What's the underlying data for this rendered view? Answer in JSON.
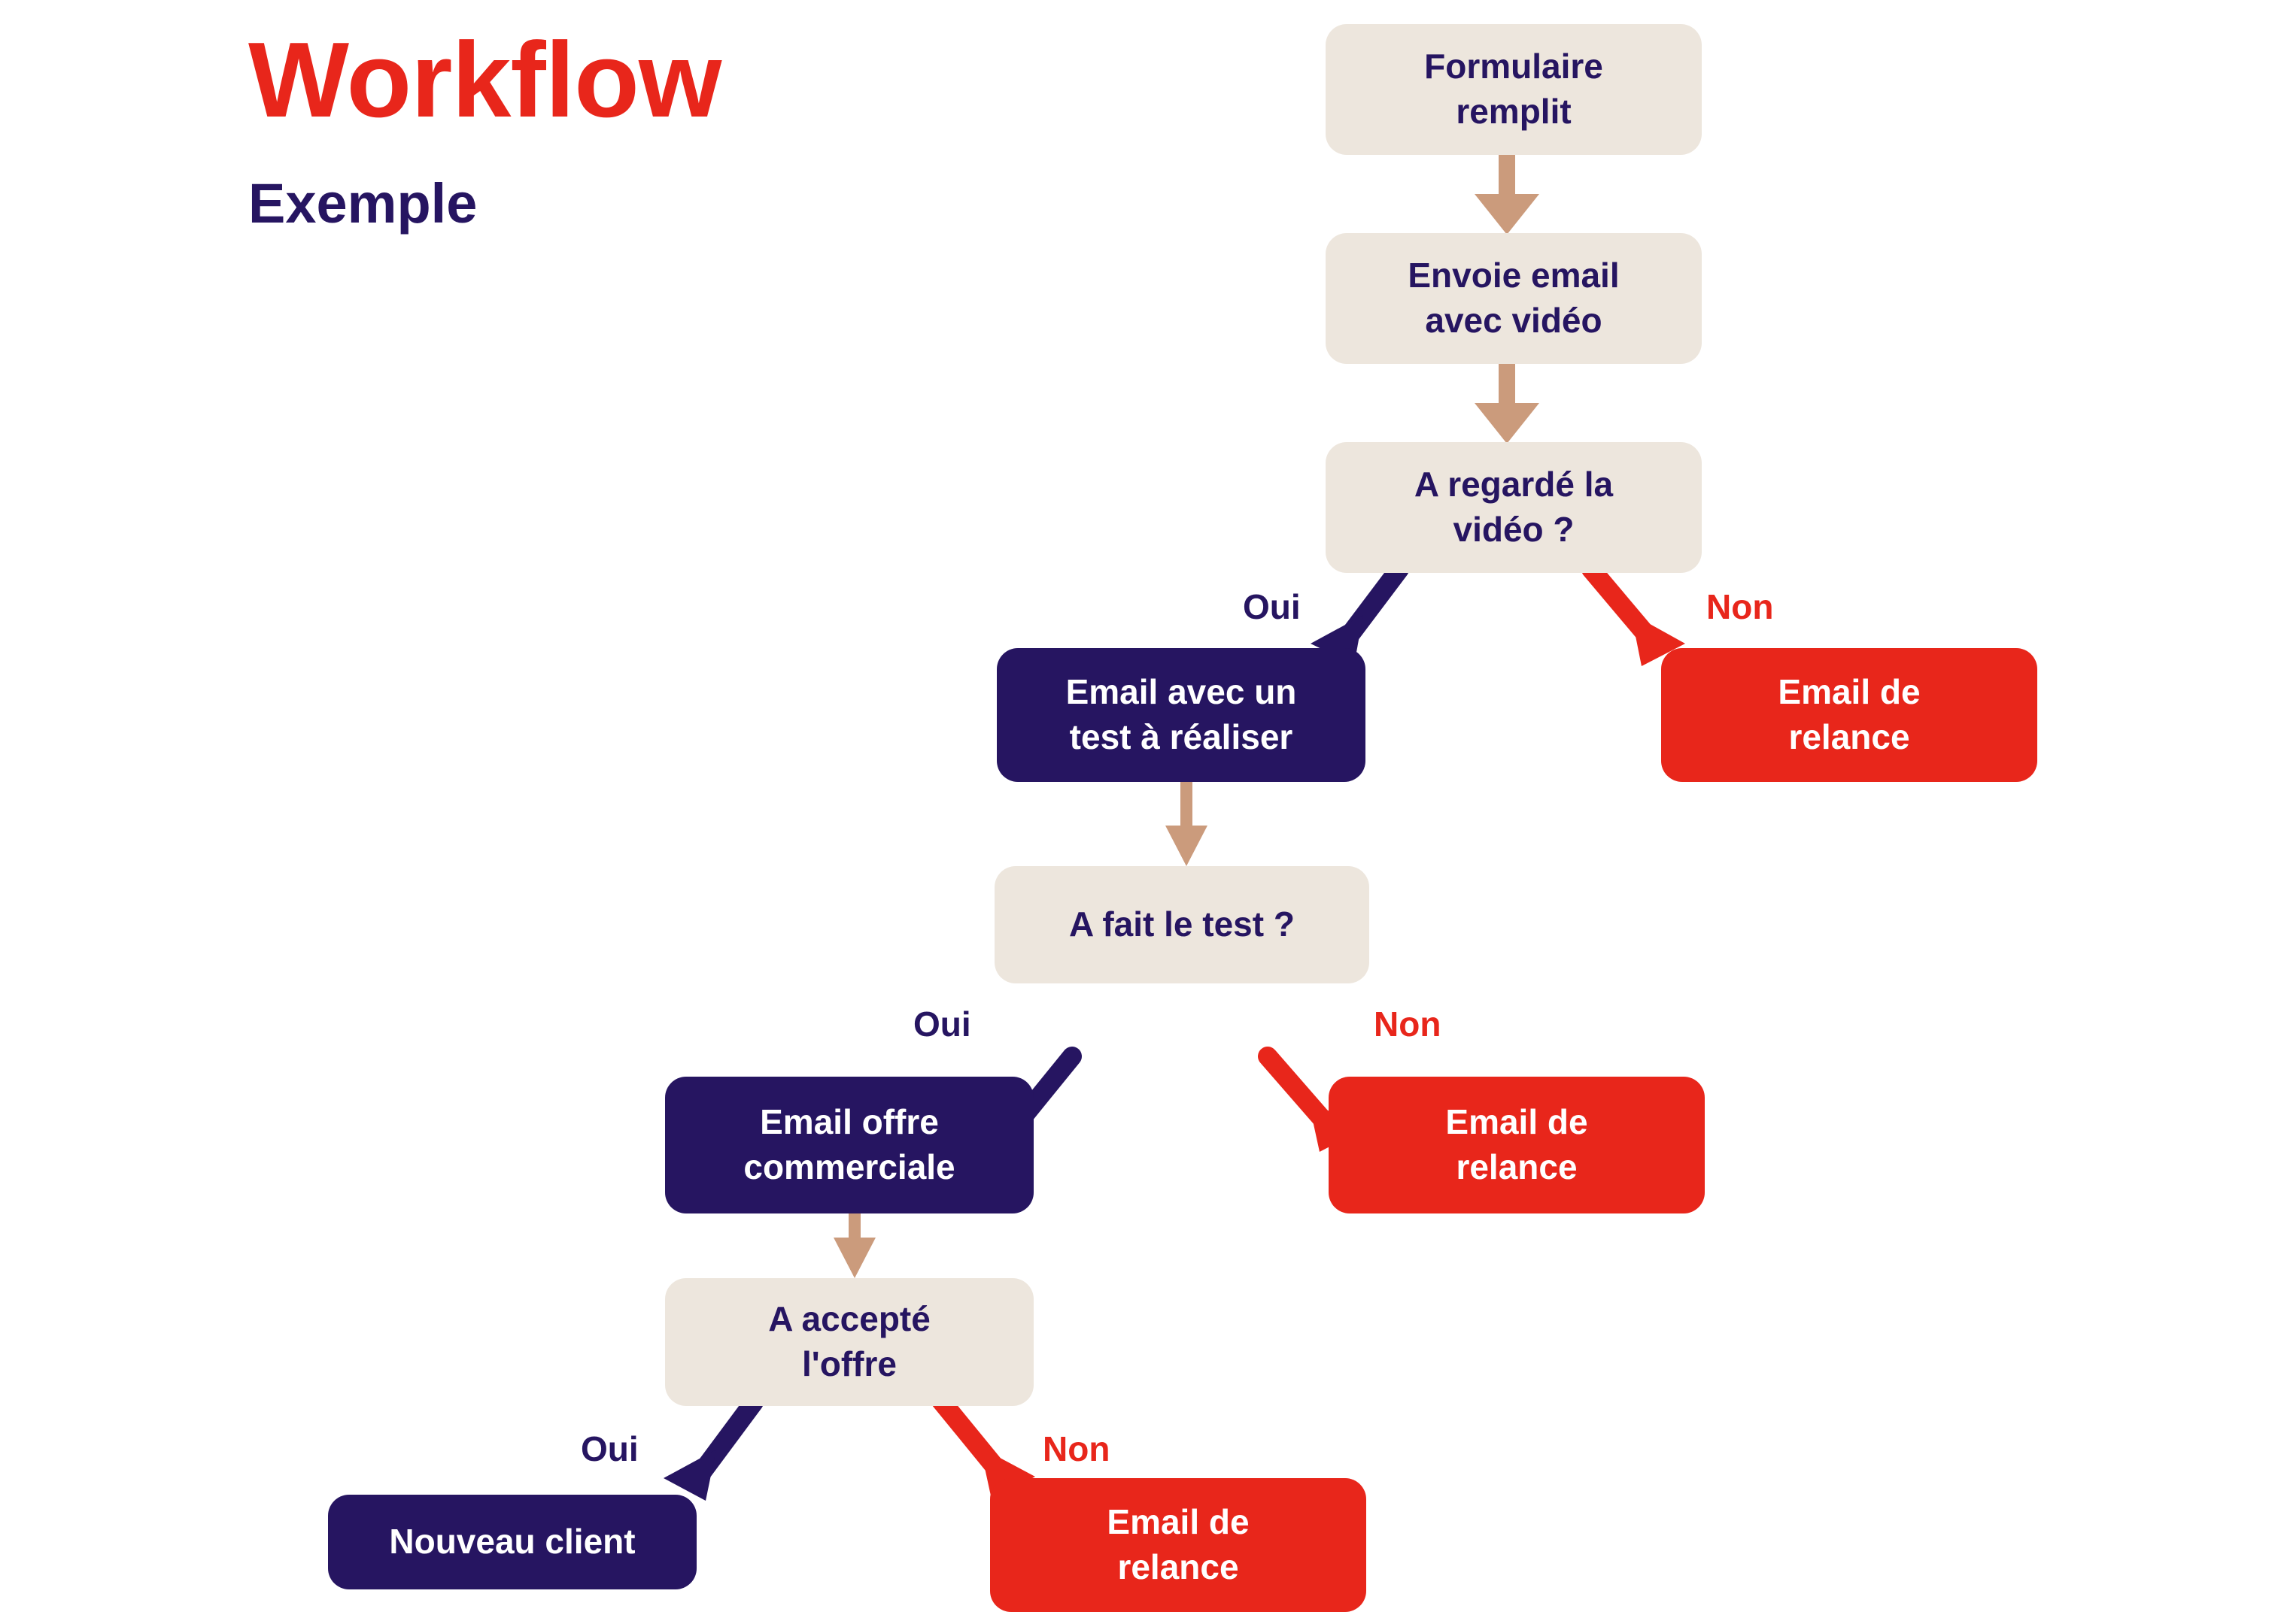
{
  "title": {
    "main": "Workflow",
    "sub": "Exemple",
    "main_color": "#E8261B",
    "sub_color": "#261561"
  },
  "palette": {
    "beige_box": "#EDE6DD",
    "navy_box": "#261561",
    "red_box": "#E8261B",
    "tan_arrow": "#CB9B7C",
    "navy_arrow": "#261561",
    "red_arrow": "#E8261B",
    "background": "#FFFFFF",
    "navy_text": "#261561",
    "white_text": "#FFFFFF"
  },
  "nodes": {
    "n1": {
      "label": "Formulaire\nremplit",
      "type": "beige"
    },
    "n2": {
      "label": "Envoie email\navec vidéo",
      "type": "beige"
    },
    "n3": {
      "label": "A regardé la\nvidéo ?",
      "type": "beige"
    },
    "n4": {
      "label": "Email avec un\ntest à réaliser",
      "type": "navy"
    },
    "n5": {
      "label": "Email de\nrelance",
      "type": "red"
    },
    "n6": {
      "label": "A fait le test ?",
      "type": "beige"
    },
    "n7": {
      "label": "Email offre\ncommerciale",
      "type": "navy"
    },
    "n8": {
      "label": "Email de\nrelance",
      "type": "red"
    },
    "n9": {
      "label": "A accepté\nl'offre",
      "type": "beige"
    },
    "n10": {
      "label": "Nouveau client",
      "type": "navy"
    },
    "n11": {
      "label": "Email de\nrelance",
      "type": "red"
    }
  },
  "edge_labels": {
    "l1_yes": "Oui",
    "l1_no": "Non",
    "l2_yes": "Oui",
    "l2_no": "Non",
    "l3_yes": "Oui",
    "l3_no": "Non"
  },
  "flow": {
    "edges": [
      {
        "from": "n1",
        "to": "n2",
        "kind": "sequence",
        "color": "#CB9B7C"
      },
      {
        "from": "n2",
        "to": "n3",
        "kind": "sequence",
        "color": "#CB9B7C"
      },
      {
        "from": "n3",
        "to": "n4",
        "kind": "yes",
        "label": "Oui",
        "color": "#261561"
      },
      {
        "from": "n3",
        "to": "n5",
        "kind": "no",
        "label": "Non",
        "color": "#E8261B"
      },
      {
        "from": "n4",
        "to": "n6",
        "kind": "sequence",
        "color": "#CB9B7C"
      },
      {
        "from": "n6",
        "to": "n7",
        "kind": "yes",
        "label": "Oui",
        "color": "#261561"
      },
      {
        "from": "n6",
        "to": "n8",
        "kind": "no",
        "label": "Non",
        "color": "#E8261B"
      },
      {
        "from": "n7",
        "to": "n9",
        "kind": "sequence",
        "color": "#CB9B7C"
      },
      {
        "from": "n9",
        "to": "n10",
        "kind": "yes",
        "label": "Oui",
        "color": "#261561"
      },
      {
        "from": "n9",
        "to": "n11",
        "kind": "no",
        "label": "Non",
        "color": "#E8261B"
      }
    ]
  }
}
